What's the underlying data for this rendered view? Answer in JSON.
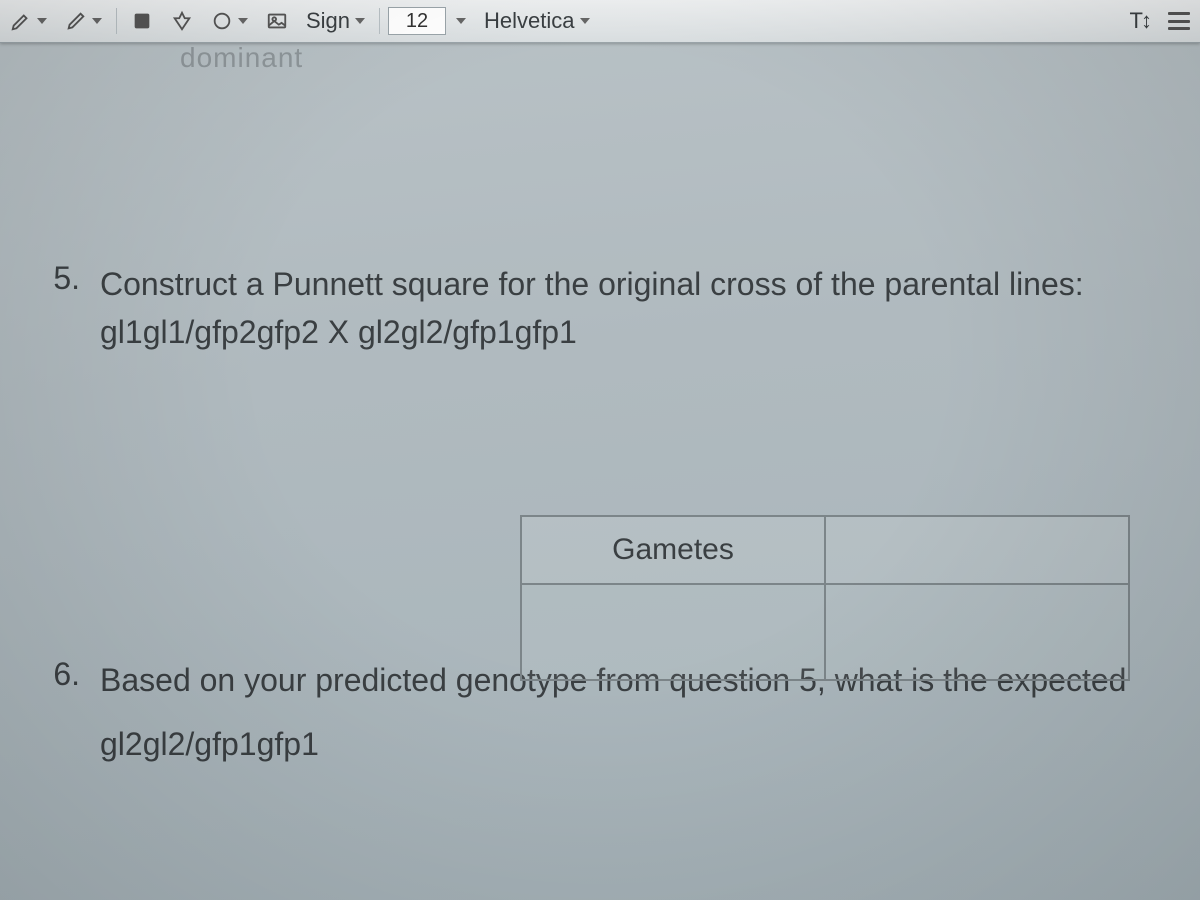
{
  "toolbar": {
    "sign_label": "Sign",
    "font_size": "12",
    "font_name": "Helvetica",
    "text_height_label": "T↕"
  },
  "ghost_word": "dominant",
  "q5": {
    "num": "5.",
    "line1": "Construct a Punnett square for the original cross of the parental lines:",
    "line2": "gl1gl1/gfp2gfp2 X gl2gl2/gfp1gfp1"
  },
  "punnett": {
    "header": "Gametes"
  },
  "q6": {
    "num": "6.",
    "line1": "Based on your predicted genotype from question 5, what is the expected",
    "sub": "gl2gl2/gfp1gfp1"
  }
}
